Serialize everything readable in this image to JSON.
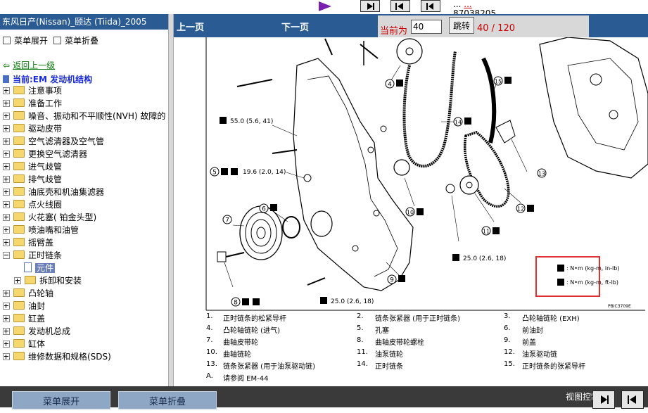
{
  "top": {
    "info_line1": "...",
    "info_red": "...",
    "info_number": "87038205"
  },
  "left": {
    "vendor_title": "东风日产(Nissan)_颐达 (Tiida)_2005",
    "menu_expand": "菜单展开",
    "menu_collapse": "菜单折叠",
    "back_link": "返回上一级",
    "current": "当前:EM 发动机结构",
    "tree": [
      "注意事项",
      "准备工作",
      "噪音、振动和不平顺性(NVH) 故障的",
      "驱动皮带",
      "空气滤清器及空气管",
      "更换空气滤清器",
      "进气歧管",
      "排气歧管",
      "油底壳和机油集滤器",
      "点火线圈",
      "火花塞( 铂金头型)",
      "喷油嘴和油管",
      "摇臂盖",
      "正时链条",
      "元件",
      "拆卸和安装",
      "凸轮轴",
      "油封",
      "缸盖",
      "发动机总成",
      "缸体",
      "维修数据和规格(SDS)"
    ]
  },
  "nav": {
    "prev": "上一页",
    "next": "下一页",
    "current_label": "当前为",
    "page_value": "40",
    "go_button": "跳转",
    "page_count": "40 / 120"
  },
  "diagram": {
    "torque_1": "55.0 (5.6, 41)",
    "torque_2": "19.6 (2.0, 14)",
    "torque_3": "25.0 (2.6, 18)",
    "torque_4": "25.0 (2.6, 18)",
    "legend_1": ": N•m (kg-m, in-lb)",
    "legend_2": ": N•m (kg-m, ft-lb)",
    "figure_id": "PBIC3709E",
    "legend_color": "#e03030"
  },
  "parts": [
    "1.",
    "正时链条的松紧导杆",
    "2.",
    "链条张紧器 (用于正时链条)",
    "3.",
    "凸轮轴链轮 (EXH)",
    "4.",
    "凸轮轴链轮 (进气)",
    "5.",
    "孔塞",
    "6.",
    "前油封",
    "7.",
    "曲轴皮带轮",
    "8.",
    "曲轴皮带轮螺栓",
    "9.",
    "前盖",
    "10.",
    "曲轴链轮",
    "11.",
    "油泵链轮",
    "12.",
    "油泵驱动链",
    "13.",
    "链条张紧器 (用于油泵驱动链)",
    "14.",
    "正时链条",
    "15.",
    "正时链条的张紧导杆",
    "A.",
    "请参阅 EM-44"
  ],
  "bottom": {
    "expand": "菜单展开",
    "collapse": "菜单折叠",
    "view_label": "视图控制"
  },
  "colors": {
    "header_blue": "#2a5b93",
    "red": "#cc0000",
    "bottom_bar": "#3a3a3a"
  }
}
